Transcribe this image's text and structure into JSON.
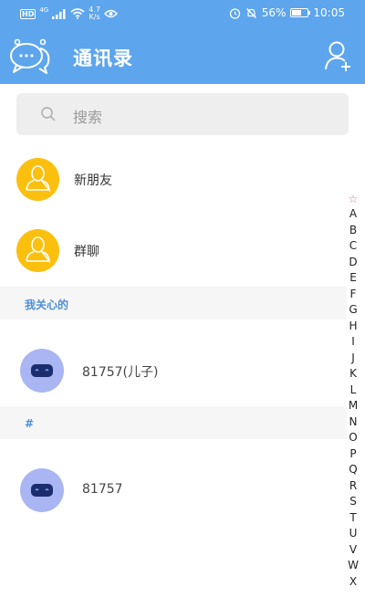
{
  "status_bar": {
    "network_type": "4G",
    "speed_value": "4.7",
    "speed_unit": "K/s",
    "battery": "56%",
    "time": "10:05"
  },
  "header": {
    "title": "通讯录",
    "background_color": "#5da5ec"
  },
  "search": {
    "placeholder": "搜索"
  },
  "entries": [
    {
      "label": "新朋友",
      "icon": "person-icon",
      "color": "#fbbf0e"
    },
    {
      "label": "群聊",
      "icon": "person-icon",
      "color": "#fbbf0e"
    }
  ],
  "sections": [
    {
      "title": "我关心的",
      "contacts": [
        {
          "name": "81757(儿子)"
        }
      ]
    },
    {
      "title": "#",
      "contacts": [
        {
          "name": "81757"
        }
      ]
    }
  ],
  "alphabet_index": {
    "star": "☆",
    "letters": [
      "A",
      "B",
      "C",
      "D",
      "E",
      "F",
      "G",
      "H",
      "I",
      "J",
      "K",
      "L",
      "M",
      "N",
      "O",
      "P",
      "Q",
      "R",
      "S",
      "T",
      "U",
      "V",
      "W",
      "X"
    ]
  }
}
